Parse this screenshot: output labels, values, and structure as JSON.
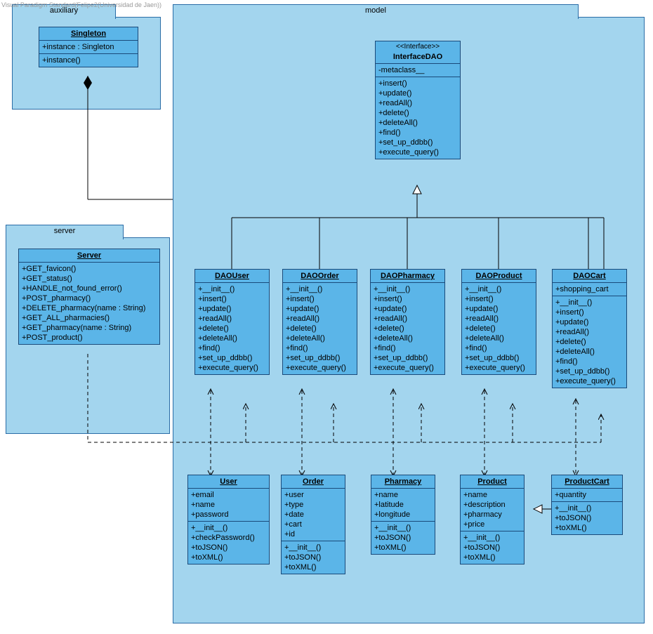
{
  "watermark": "Visual Paradigm Standard(Felipe2(Universidad de Jaen))",
  "packages": {
    "auxiliary": "auxiliary",
    "model": "model",
    "server": "server"
  },
  "classes": {
    "singleton": {
      "name": "Singleton",
      "attrs": [
        "+instance : Singleton"
      ],
      "ops": [
        "+instance()"
      ]
    },
    "interfacedao": {
      "stereo": "<<Interface>>",
      "name": "InterfaceDAO",
      "attrs": [
        "-metaclass__"
      ],
      "ops": [
        "+insert()",
        "+update()",
        "+readAll()",
        "+delete()",
        "+deleteAll()",
        "+find()",
        "+set_up_ddbb()",
        "+execute_query()"
      ]
    },
    "server": {
      "name": "Server",
      "ops": [
        "+GET_favicon()",
        "+GET_status()",
        "+HANDLE_not_found_error()",
        "+POST_pharmacy()",
        "+DELETE_pharmacy(name : String)",
        "+GET_ALL_pharmacies()",
        "+GET_pharmacy(name : String)",
        "+POST_product()"
      ]
    },
    "daouser": {
      "name": "DAOUser",
      "ops": [
        "+__init__()",
        "+insert()",
        "+update()",
        "+readAll()",
        "+delete()",
        "+deleteAll()",
        "+find()",
        "+set_up_ddbb()",
        "+execute_query()"
      ]
    },
    "daoorder": {
      "name": "DAOOrder",
      "ops": [
        "+__init__()",
        "+insert()",
        "+update()",
        "+readAll()",
        "+delete()",
        "+deleteAll()",
        "+find()",
        "+set_up_ddbb()",
        "+execute_query()"
      ]
    },
    "daopharmacy": {
      "name": "DAOPharmacy",
      "ops": [
        "+__init__()",
        "+insert()",
        "+update()",
        "+readAll()",
        "+delete()",
        "+deleteAll()",
        "+find()",
        "+set_up_ddbb()",
        "+execute_query()"
      ]
    },
    "daoproduct": {
      "name": "DAOProduct",
      "ops": [
        "+__init__()",
        "+insert()",
        "+update()",
        "+readAll()",
        "+delete()",
        "+deleteAll()",
        "+find()",
        "+set_up_ddbb()",
        "+execute_query()"
      ]
    },
    "daocart": {
      "name": "DAOCart",
      "attrs": [
        "+shopping_cart"
      ],
      "ops": [
        "+__init__()",
        "+insert()",
        "+update()",
        "+readAll()",
        "+delete()",
        "+deleteAll()",
        "+find()",
        "+set_up_ddbb()",
        "+execute_query()"
      ]
    },
    "user": {
      "name": "User",
      "attrs": [
        "+email",
        "+name",
        "+password"
      ],
      "ops": [
        "+__init__()",
        "+checkPassword()",
        "+toJSON()",
        "+toXML()"
      ]
    },
    "order": {
      "name": "Order",
      "attrs": [
        "+user",
        "+type",
        "+date",
        "+cart",
        "+id"
      ],
      "ops": [
        "+__init__()",
        "+toJSON()",
        "+toXML()"
      ]
    },
    "pharmacy": {
      "name": "Pharmacy",
      "attrs": [
        "+name",
        "+latitude",
        "+longitude"
      ],
      "ops": [
        "+__init__()",
        "+toJSON()",
        "+toXML()"
      ]
    },
    "product": {
      "name": "Product",
      "attrs": [
        "+name",
        "+description",
        "+pharmacy",
        "+price"
      ],
      "ops": [
        "+__init__()",
        "+toJSON()",
        "+toXML()"
      ]
    },
    "productcart": {
      "name": "ProductCart",
      "attrs": [
        "+quantity"
      ],
      "ops": [
        "+__init__()",
        "+toJSON()",
        "+toXML()"
      ]
    }
  }
}
